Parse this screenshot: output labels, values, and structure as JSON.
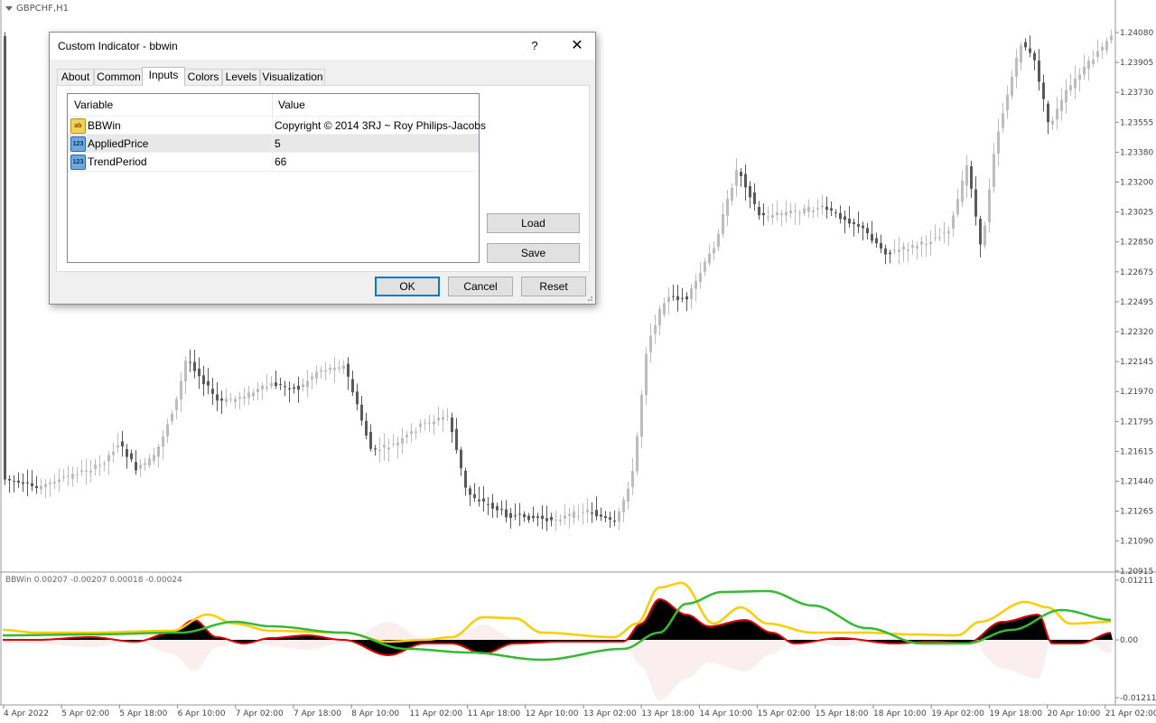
{
  "chart": {
    "symbol": "GBPCHF,H1",
    "indicator_label": "BBWin 0.00207 -0.00207 0.00018 -0.00024",
    "price_axis": [
      "1.24080",
      "1.23905",
      "1.23730",
      "1.23555",
      "1.23380",
      "1.23200",
      "1.23025",
      "1.22850",
      "1.22675",
      "1.22495",
      "1.22320",
      "1.22145",
      "1.21970",
      "1.21795",
      "1.21615",
      "1.21440",
      "1.21265",
      "1.21090",
      "1.20915"
    ],
    "indicator_axis": [
      "0.01211",
      "0.00",
      "-0.01211"
    ],
    "time_axis": [
      "4 Apr 2022",
      "5 Apr 02:00",
      "5 Apr 18:00",
      "6 Apr 10:00",
      "7 Apr 02:00",
      "7 Apr 18:00",
      "8 Apr 10:00",
      "11 Apr 02:00",
      "11 Apr 18:00",
      "12 Apr 10:00",
      "13 Apr 02:00",
      "13 Apr 18:00",
      "14 Apr 10:00",
      "15 Apr 02:00",
      "15 Apr 18:00",
      "18 Apr 10:00",
      "19 Apr 02:00",
      "19 Apr 18:00",
      "20 Apr 10:00",
      "21 Apr 02:00"
    ],
    "colors": {
      "candle_up": "#bdbdbd",
      "candle_down": "#5a5a5a",
      "histogram": "#000000",
      "red_line": "#e00000",
      "yellow_line": "#ffcc00",
      "green_line": "#33bb33",
      "fade": "#fbeeee"
    }
  },
  "dialog": {
    "title": "Custom Indicator - bbwin",
    "help": "?",
    "close": "✕",
    "tabs": [
      "About",
      "Common",
      "Inputs",
      "Colors",
      "Levels",
      "Visualization"
    ],
    "active_tab": "Inputs",
    "grid": {
      "headers": {
        "variable": "Variable",
        "value": "Value"
      },
      "rows": [
        {
          "icon": "ab",
          "name": "BBWin",
          "value": "Copyright © 2014 3RJ ~ Roy Philips-Jacobs"
        },
        {
          "icon": "123",
          "name": "AppliedPrice",
          "value": "5"
        },
        {
          "icon": "123",
          "name": "TrendPeriod",
          "value": "66"
        }
      ]
    },
    "buttons": {
      "load": "Load",
      "save": "Save",
      "ok": "OK",
      "cancel": "Cancel",
      "reset": "Reset"
    }
  }
}
